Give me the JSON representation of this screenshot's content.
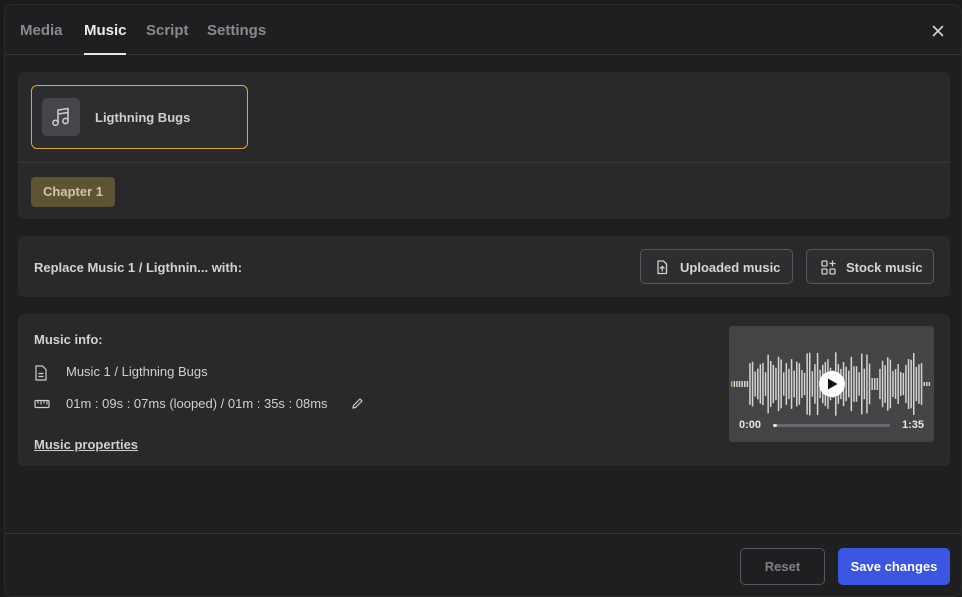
{
  "tabs": [
    {
      "label": "Media"
    },
    {
      "label": "Music"
    },
    {
      "label": "Script"
    },
    {
      "label": "Settings"
    }
  ],
  "active_tab": "Music",
  "music_track": {
    "name": "Ligthning Bugs",
    "icon": "music-note-icon"
  },
  "chapter": {
    "label": "Chapter 1"
  },
  "replace": {
    "label": "Replace Music 1 / Ligthnin... with:",
    "uploaded_label": "Uploaded music",
    "stock_label": "Stock music"
  },
  "info": {
    "title": "Music info:",
    "file": "Music 1 / Ligthning Bugs",
    "duration": "01m : 09s : 07ms (looped) / 01m : 35s : 08ms",
    "properties_link": "Music properties"
  },
  "player": {
    "current_time": "0:00",
    "total_time": "1:35",
    "progress": 0.03
  },
  "footer": {
    "reset_label": "Reset",
    "save_label": "Save changes"
  },
  "colors": {
    "accent": "#3b56e0",
    "selected_border": "#d9a93a",
    "chapter_chip": "#5d5434"
  }
}
